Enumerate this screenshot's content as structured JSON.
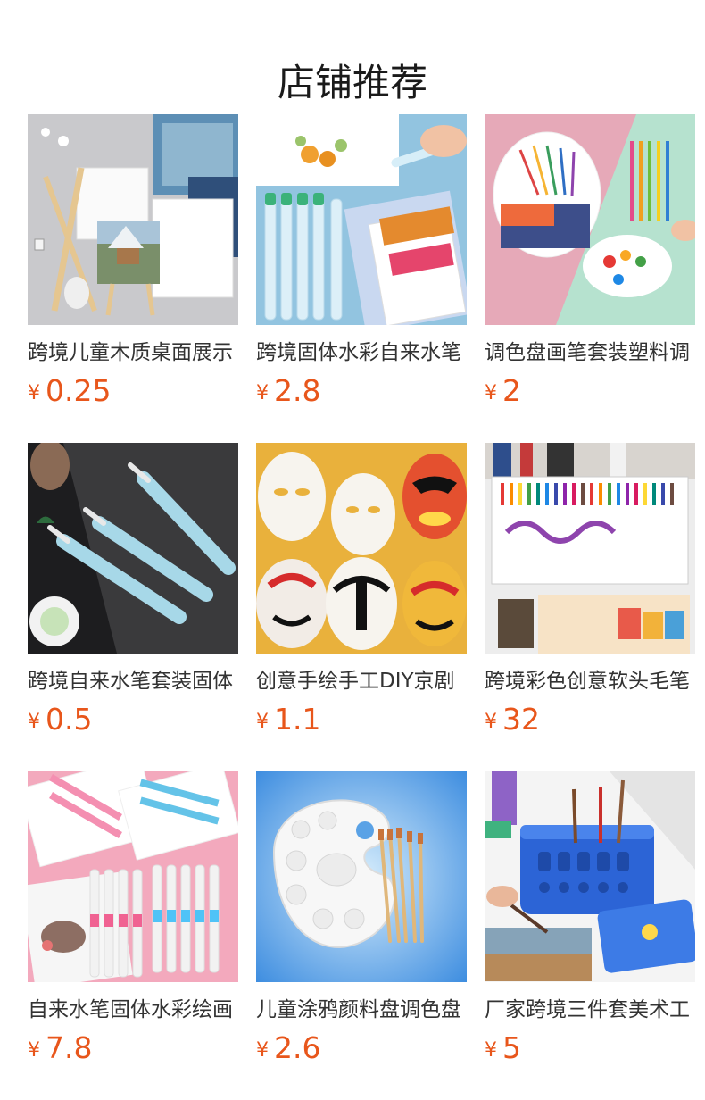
{
  "header": {
    "title": "店铺推荐"
  },
  "currency": "¥",
  "colors": {
    "price": "#e8561b"
  },
  "products": [
    {
      "name": "跨境儿童木质桌面展示",
      "price": "0.25",
      "image": "easel-canvas-image"
    },
    {
      "name": "跨境固体水彩自来水笔",
      "price": "2.8",
      "image": "water-brush-pens-image"
    },
    {
      "name": "调色盘画笔套装塑料调",
      "price": "2",
      "image": "palette-brush-set-image"
    },
    {
      "name": "跨境自来水笔套装固体",
      "price": "0.5",
      "image": "water-brush-trio-image"
    },
    {
      "name": "创意手绘手工DIY京剧",
      "price": "1.1",
      "image": "opera-masks-image"
    },
    {
      "name": "跨境彩色创意软头毛笔",
      "price": "32",
      "image": "watercolor-brush-pen-image"
    },
    {
      "name": "自来水笔固体水彩绘画",
      "price": "7.8",
      "image": "water-brush-set-image"
    },
    {
      "name": "儿童涂鸦颜料盘调色盘",
      "price": "2.6",
      "image": "paint-palette-image"
    },
    {
      "name": "厂家跨境三件套美术工",
      "price": "5",
      "image": "brush-washer-bucket-image"
    }
  ]
}
